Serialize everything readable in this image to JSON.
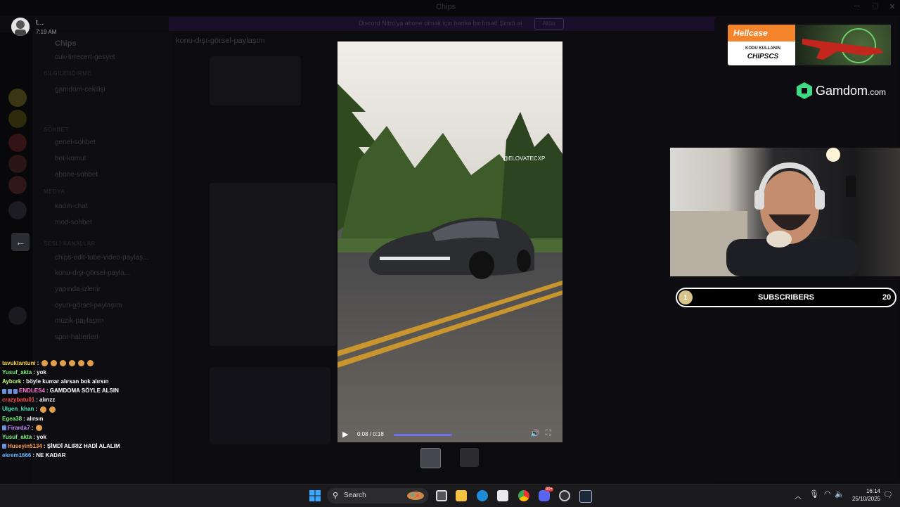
{
  "background_app": {
    "title": "Chips",
    "server_name": "Chips",
    "banner_text": "Discord Nitro'ya abone olmak için harika bir fırsat! Şimdi al",
    "banner_button": "Aktar",
    "header_channel": "konu-dışı-görsel-paylaşım",
    "categories": [
      "BİLGİLENDİRME",
      "SOHBET",
      "MEDYA",
      "SESLİ KANALLAR"
    ],
    "channels": [
      "cuk-tirrecert-gesyet",
      "gamdom-cekilişi",
      "genel-sohbet",
      "bot-komut",
      "abone-sohbet",
      "kadın-chat",
      "mod-sohbet",
      "chips-edit-tube-video-paylaş...",
      "konu-dışı-görsel-payla...",
      "yapında-izlenir",
      "oyun-görsel-paylaşım",
      "müzik-paylaşım",
      "spor-haberleri"
    ]
  },
  "viewer": {
    "user_name": "t...",
    "timestamp": "7:19 AM",
    "back_icon": "arrow-left-icon",
    "video": {
      "watermark": "@ELOVATECXP",
      "time": "0:08 / 0:18",
      "progress": 0.44,
      "play_icon": "play-icon",
      "volume_icon": "volume-icon",
      "fullscreen_icon": "fullscreen-icon"
    }
  },
  "chat": [
    {
      "user": "tavuktantuni",
      "color": "#f7d43c",
      "text": "",
      "emotes": 6
    },
    {
      "user": "Yusuf_akta",
      "color": "#7ff07f",
      "text": "yok",
      "emotes": 0
    },
    {
      "user": "Aybork",
      "color": "#c8ff7a",
      "text": "böyle kumar alırsan bok alırsın",
      "emotes": 0
    },
    {
      "user": "ENDLES4",
      "color": "#ff7ad8",
      "text": "GAMDOMA SÖYLE ALSIN",
      "emotes": 0,
      "badges": 3
    },
    {
      "user": "crazybatu01",
      "color": "#ff4d4d",
      "text": "alırızz",
      "emotes": 0
    },
    {
      "user": "Ulgen_khan",
      "color": "#48e6b6",
      "text": "",
      "emotes": 2
    },
    {
      "user": "Egea38",
      "color": "#7ff07f",
      "text": "alırsın",
      "emotes": 0
    },
    {
      "user": "Firarda7",
      "color": "#c38cff",
      "text": "",
      "emotes": 1,
      "badges": 1
    },
    {
      "user": "Yusuf_akta",
      "color": "#7ff07f",
      "text": "yok",
      "emotes": 0
    },
    {
      "user": "Huseyin5134",
      "color": "#ff9a4d",
      "text": "ŞİMDİ ALIRIZ HADİ ALALIM",
      "emotes": 0,
      "badges": 1
    },
    {
      "user": "ekrem1666",
      "color": "#6ab7ff",
      "text": "NE KADAR",
      "emotes": 0
    }
  ],
  "sponsors": {
    "hellcase_name": "Hellcase",
    "hellcase_kodu": "KODU KULLANIN",
    "hellcase_code": "CHIPSCS",
    "gamdom_name": "Gamdom",
    "gamdom_suffix": ".com"
  },
  "subscribers": {
    "label": "SUBSCRIBERS",
    "current": "1",
    "goal": "20"
  },
  "taskbar": {
    "search_placeholder": "Search",
    "time": "16:14",
    "date": "25/10/2025",
    "apps": [
      "start-icon",
      "task-view-icon",
      "file-explorer-icon",
      "edge-icon",
      "store-icon",
      "chrome-icon",
      "discord-icon",
      "obs-icon",
      "steam-icon"
    ],
    "discord_badge": "99+"
  }
}
